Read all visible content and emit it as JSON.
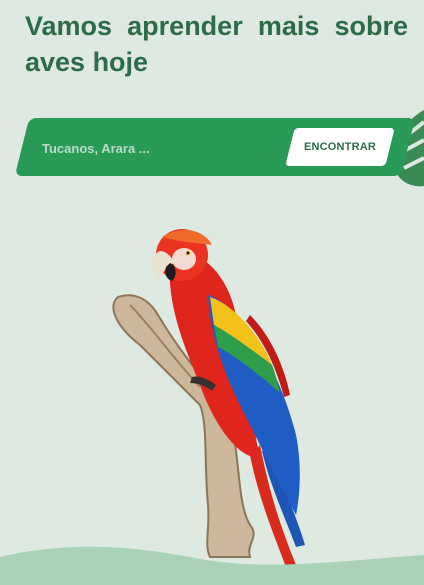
{
  "hero": {
    "headline": "Vamos aprender mais sobre aves hoje"
  },
  "search": {
    "placeholder": "Tucanos, Arara ...",
    "button_label": "ENCONTRAR"
  },
  "colors": {
    "background": "#dde9e1",
    "headline": "#2e6b49",
    "search_bar": "#2a9a57",
    "button_bg": "#ffffff",
    "ground": "#a9d2b6"
  },
  "icons": {
    "leaf": "monstera-leaf-icon",
    "illustration": "macaw-parrot-illustration"
  }
}
